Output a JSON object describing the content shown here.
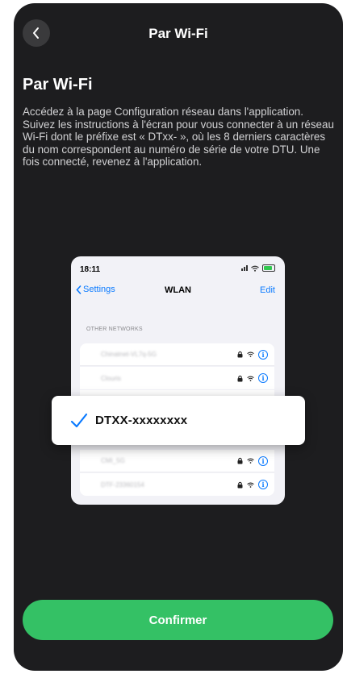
{
  "nav": {
    "title": "Par Wi-Fi"
  },
  "heading": "Par Wi-Fi",
  "description": "Accédez à la page Configuration réseau dans l'application. Suivez les instructions à l'écran pour vous connecter à un réseau Wi-Fi dont le préfixe est « DTxx- », où les 8 derniers caractères du nom correspondent au numéro de série de votre DTU. Une fois connecté, revenez à l'application.",
  "illustration": {
    "status_time": "18:11",
    "back_label": "Settings",
    "title": "WLAN",
    "edit_label": "Edit",
    "section_label": "OTHER NETWORKS",
    "networks": [
      "Chinatnet-VL7q-5G",
      "Clouris",
      "CMI_5G",
      "DTF-23360154"
    ],
    "info_glyph": "i",
    "selected_network": "DTXX-xxxxxxxx",
    "accent_color": "#0a7aff"
  },
  "confirm_label": "Confirmer",
  "colors": {
    "background": "#1d1d1f",
    "button": "#34c165"
  }
}
